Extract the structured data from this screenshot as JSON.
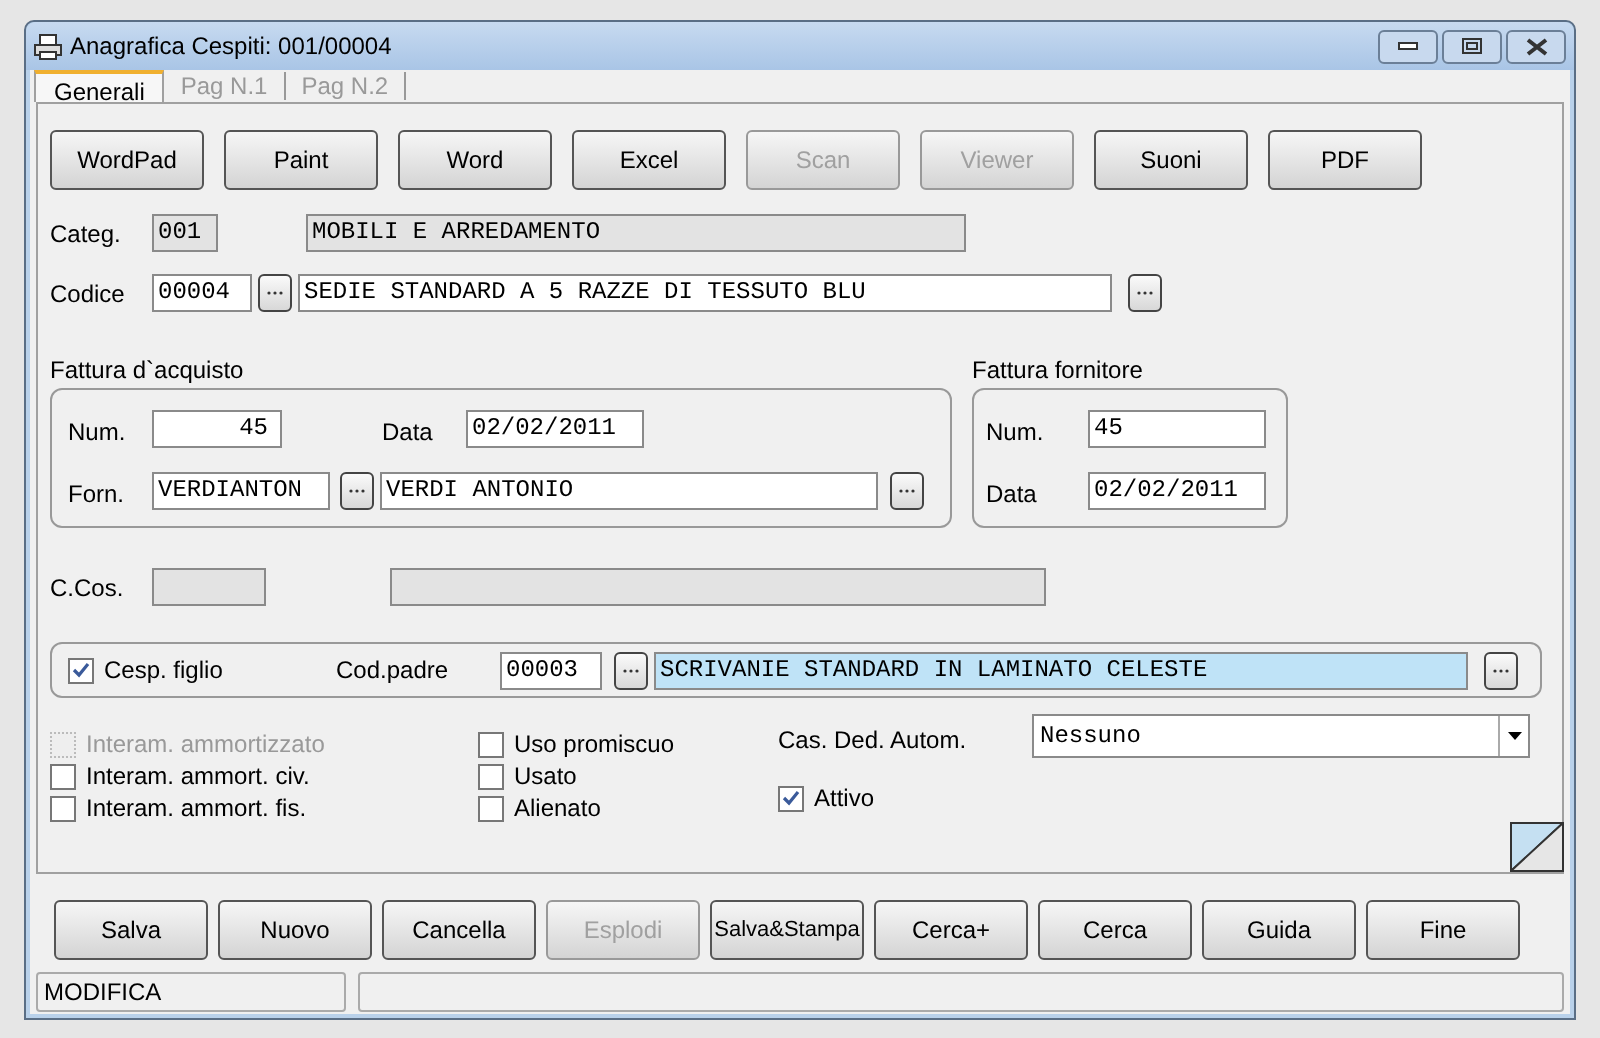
{
  "window": {
    "title": "Anagrafica Cespiti: 001/00004"
  },
  "tabs": [
    {
      "label": "Generali",
      "selected": true
    },
    {
      "label": "Pag N.1",
      "selected": false
    },
    {
      "label": "Pag N.2",
      "selected": false
    }
  ],
  "toolbar_buttons": [
    {
      "label": "WordPad",
      "disabled": false
    },
    {
      "label": "Paint",
      "disabled": false
    },
    {
      "label": "Word",
      "disabled": false
    },
    {
      "label": "Excel",
      "disabled": false
    },
    {
      "label": "Scan",
      "disabled": true
    },
    {
      "label": "Viewer",
      "disabled": true
    },
    {
      "label": "Suoni",
      "disabled": false
    },
    {
      "label": "PDF",
      "disabled": false
    }
  ],
  "categ": {
    "label": "Categ.",
    "code": "001",
    "description": "MOBILI E ARREDAMENTO"
  },
  "codice": {
    "label": "Codice",
    "code": "00004",
    "description": "SEDIE STANDARD A 5 RAZZE DI TESSUTO BLU"
  },
  "fattura_acquisto": {
    "title": "Fattura d`acquisto",
    "num_label": "Num.",
    "num": "45",
    "data_label": "Data",
    "data": "02/02/2011",
    "forn_label": "Forn.",
    "forn_code": "VERDIANTON",
    "forn_name": "VERDI ANTONIO"
  },
  "fattura_fornitore": {
    "title": "Fattura fornitore",
    "num_label": "Num.",
    "num": "45",
    "data_label": "Data",
    "data": "02/02/2011"
  },
  "ccos": {
    "label": "C.Cos."
  },
  "cesp_figlio": {
    "label": "Cesp. figlio",
    "checked": true
  },
  "cod_padre": {
    "label": "Cod.padre",
    "code": "00003",
    "description": "SCRIVANIE STANDARD IN LAMINATO CELESTE",
    "selected": true
  },
  "checkboxes_col1": [
    {
      "label": "Interam. ammortizzato",
      "checked": false,
      "disabled": true
    },
    {
      "label": "Interam. ammort. civ.",
      "checked": false,
      "disabled": false
    },
    {
      "label": "Interam. ammort. fis.",
      "checked": false,
      "disabled": false
    }
  ],
  "checkboxes_col2": [
    {
      "label": "Uso promiscuo",
      "checked": false,
      "disabled": false
    },
    {
      "label": "Usato",
      "checked": false,
      "disabled": false
    },
    {
      "label": "Alienato",
      "checked": false,
      "disabled": false
    }
  ],
  "cas_ded": {
    "label": "Cas. Ded. Autom.",
    "value": "Nessuno"
  },
  "attivo": {
    "label": "Attivo",
    "checked": true
  },
  "bottom_buttons": [
    {
      "label": "Salva",
      "disabled": false
    },
    {
      "label": "Nuovo",
      "disabled": false
    },
    {
      "label": "Cancella",
      "disabled": false
    },
    {
      "label": "Esplodi",
      "disabled": true
    },
    {
      "label": "Salva&Stampa",
      "disabled": false,
      "kind": "small"
    },
    {
      "label": "Cerca+",
      "disabled": false
    },
    {
      "label": "Cerca",
      "disabled": false
    },
    {
      "label": "Guida",
      "disabled": false
    },
    {
      "label": "Fine",
      "disabled": false
    }
  ],
  "status_bar": {
    "mode": "MODIFICA"
  }
}
